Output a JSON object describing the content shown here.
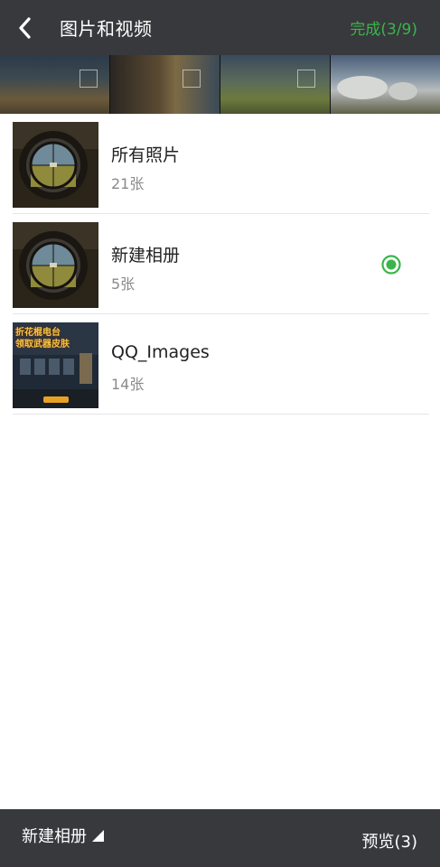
{
  "header": {
    "title": "图片和视频",
    "done_label": "完成(3/9)",
    "accent_color": "#39b54a"
  },
  "albums": [
    {
      "name": "所有照片",
      "count": "21张",
      "icon": "scope-thumbnail",
      "selected": false
    },
    {
      "name": "新建相册",
      "count": "5张",
      "icon": "scope-thumbnail",
      "selected": true
    },
    {
      "name": "QQ_Images",
      "count": "14张",
      "icon": "game-poster-thumbnail",
      "selected": false
    }
  ],
  "poster_text": "折花棍电台\n领取武器皮肤",
  "footer": {
    "album_label": "新建相册",
    "preview_label": "预览(3)"
  }
}
